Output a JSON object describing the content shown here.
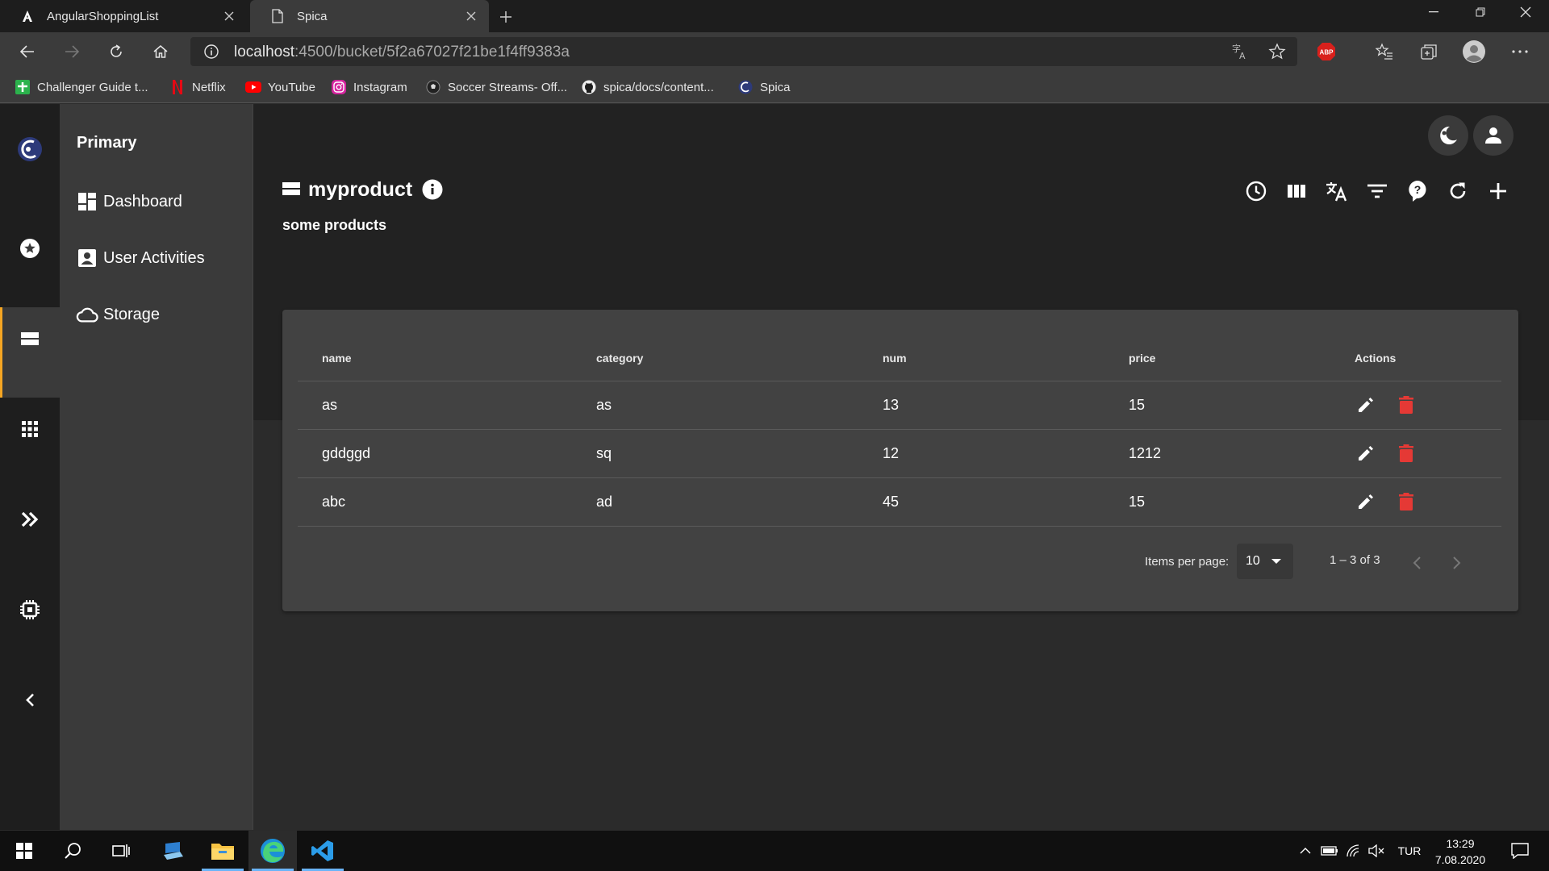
{
  "browser": {
    "tabs": [
      {
        "title": "AngularShoppingList",
        "icon": "angular-icon"
      },
      {
        "title": "Spica",
        "icon": "page-icon"
      }
    ],
    "url_host": "localhost",
    "url_path": ":4500/bucket/5f2a67027f21be1f4ff9383a",
    "bookmarks": [
      {
        "label": "Challenger Guide t...",
        "icon": "green-cross-icon"
      },
      {
        "label": "Netflix",
        "icon": "netflix-icon"
      },
      {
        "label": "YouTube",
        "icon": "youtube-icon"
      },
      {
        "label": "Instagram",
        "icon": "instagram-icon"
      },
      {
        "label": "Soccer Streams- Off...",
        "icon": "soccer-ball-icon"
      },
      {
        "label": "spica/docs/content...",
        "icon": "github-icon"
      },
      {
        "label": "Spica",
        "icon": "spica-icon"
      }
    ],
    "extension_badge": "ABP"
  },
  "menu": {
    "title": "Primary",
    "items": [
      {
        "label": "Dashboard",
        "icon": "dashboard-icon"
      },
      {
        "label": "User Activities",
        "icon": "account-box-icon"
      },
      {
        "label": "Storage",
        "icon": "cloud-icon"
      }
    ]
  },
  "bucket": {
    "title": "myproduct",
    "description": "some products"
  },
  "table": {
    "columns": [
      "name",
      "category",
      "num",
      "price",
      "Actions"
    ],
    "rows": [
      {
        "name": "as",
        "category": "as",
        "num": "13",
        "price": "15"
      },
      {
        "name": "gddggd",
        "category": "sq",
        "num": "12",
        "price": "1212"
      },
      {
        "name": "abc",
        "category": "ad",
        "num": "45",
        "price": "15"
      }
    ]
  },
  "paginator": {
    "items_per_page_label": "Items per page:",
    "items_per_page": "10",
    "range": "1 – 3 of 3"
  },
  "taskbar": {
    "language": "TUR",
    "time": "13:29",
    "date": "7.08.2020"
  },
  "colors": {
    "accent": "#f5a623",
    "delete": "#e53935",
    "background": "#2b2b2b",
    "card": "#424242"
  }
}
